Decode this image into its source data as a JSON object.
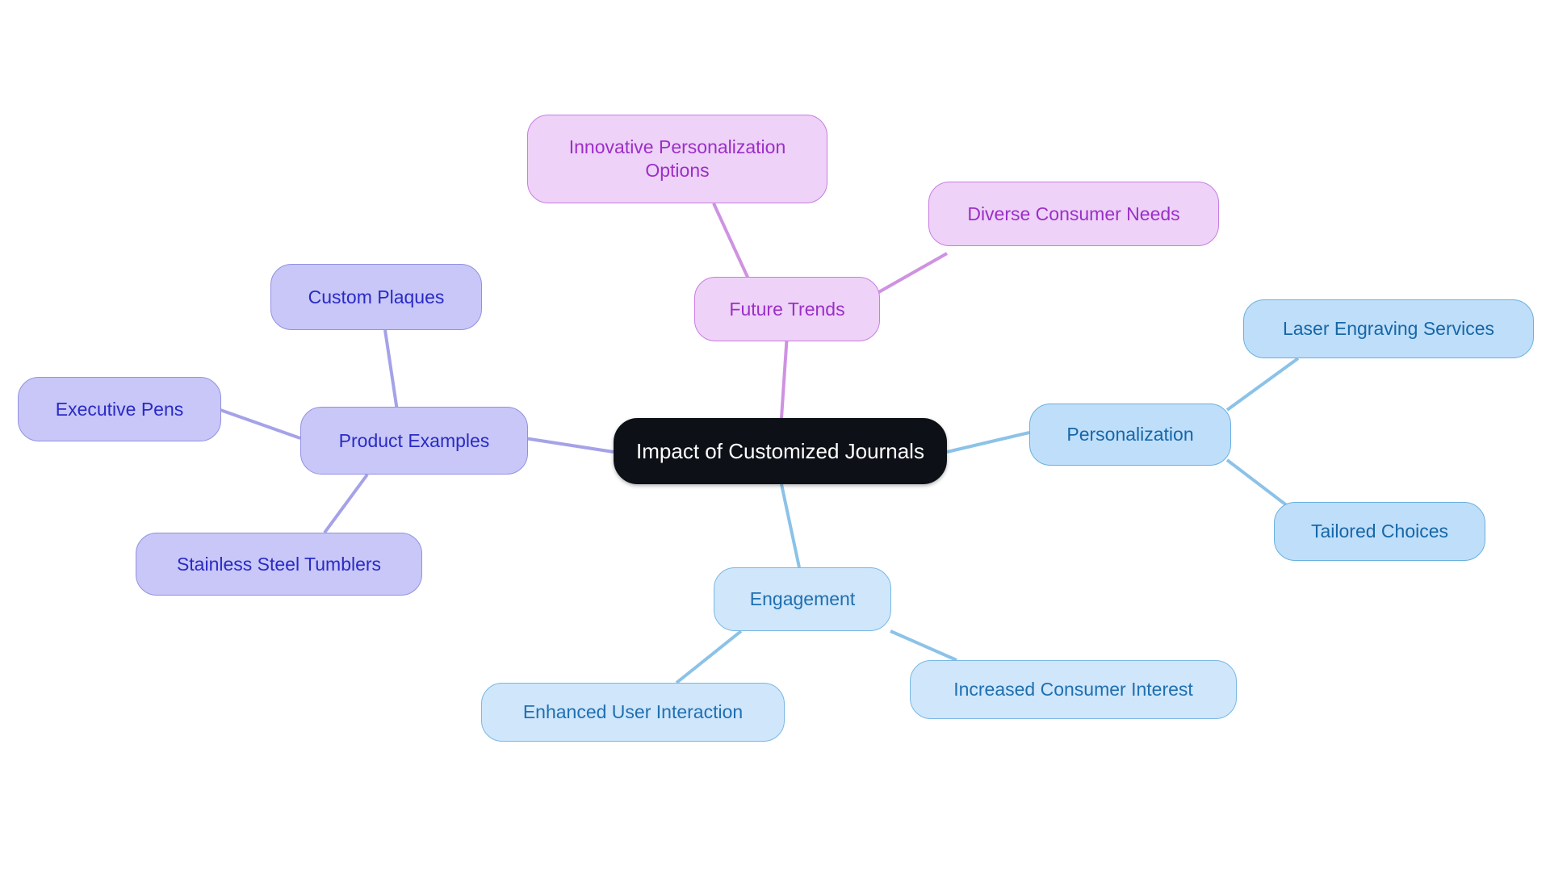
{
  "diagram": {
    "type": "mindmap",
    "title": "Impact of Customized Journals",
    "background": "#ffffff",
    "palette": {
      "root_fill": "#0d1117",
      "root_text": "#ffffff",
      "blue_fill": "#bfdef9",
      "blue_border": "#6ab0de",
      "blue_text": "#1667a8",
      "blue_light_fill": "#cfe6fb",
      "blue_light_border": "#79b8e3",
      "periwinkle_fill": "#c8c7f7",
      "periwinkle_border": "#9390e2",
      "periwinkle_text": "#2a2ac6",
      "violet_fill": "#eed2f7",
      "violet_border": "#c87de2",
      "violet_text": "#9b2fc8",
      "edge_blue": "#8cc2e8",
      "edge_periwinkle": "#a5a2e8",
      "edge_violet": "#cf92e2"
    }
  },
  "nodes": {
    "root": {
      "label": "Impact of Customized Journals"
    },
    "personalization": {
      "label": "Personalization"
    },
    "laser_engraving_services": {
      "label": "Laser Engraving Services"
    },
    "tailored_choices": {
      "label": "Tailored Choices"
    },
    "engagement": {
      "label": "Engagement"
    },
    "enhanced_user_interaction": {
      "label": "Enhanced User Interaction"
    },
    "increased_consumer_interest": {
      "label": "Increased Consumer Interest"
    },
    "product_examples": {
      "label": "Product Examples"
    },
    "custom_plaques": {
      "label": "Custom Plaques"
    },
    "executive_pens": {
      "label": "Executive Pens"
    },
    "stainless_steel_tumblers": {
      "label": "Stainless Steel Tumblers"
    },
    "future_trends": {
      "label": "Future Trends"
    },
    "innovative_personalization_options": {
      "label": "Innovative Personalization\nOptions"
    },
    "diverse_consumer_needs": {
      "label": "Diverse Consumer Needs"
    }
  },
  "chart_data": {
    "type": "mindmap",
    "title": "Impact of Customized Journals",
    "root": "Impact of Customized Journals",
    "branches": [
      {
        "name": "Personalization",
        "color": "blue",
        "children": [
          "Laser Engraving Services",
          "Tailored Choices"
        ]
      },
      {
        "name": "Engagement",
        "color": "blue",
        "children": [
          "Enhanced User Interaction",
          "Increased Consumer Interest"
        ]
      },
      {
        "name": "Product Examples",
        "color": "periwinkle",
        "children": [
          "Custom Plaques",
          "Executive Pens",
          "Stainless Steel Tumblers"
        ]
      },
      {
        "name": "Future Trends",
        "color": "violet",
        "children": [
          "Innovative Personalization Options",
          "Diverse Consumer Needs"
        ]
      }
    ],
    "edges": [
      [
        "Impact of Customized Journals",
        "Personalization"
      ],
      [
        "Impact of Customized Journals",
        "Engagement"
      ],
      [
        "Impact of Customized Journals",
        "Product Examples"
      ],
      [
        "Impact of Customized Journals",
        "Future Trends"
      ],
      [
        "Personalization",
        "Laser Engraving Services"
      ],
      [
        "Personalization",
        "Tailored Choices"
      ],
      [
        "Engagement",
        "Enhanced User Interaction"
      ],
      [
        "Engagement",
        "Increased Consumer Interest"
      ],
      [
        "Product Examples",
        "Custom Plaques"
      ],
      [
        "Product Examples",
        "Executive Pens"
      ],
      [
        "Product Examples",
        "Stainless Steel Tumblers"
      ],
      [
        "Future Trends",
        "Innovative Personalization Options"
      ],
      [
        "Future Trends",
        "Diverse Consumer Needs"
      ]
    ]
  }
}
